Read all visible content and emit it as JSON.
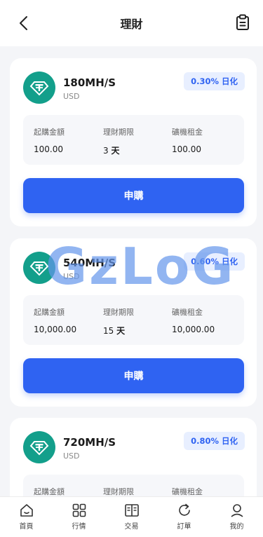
{
  "header": {
    "title": "理財"
  },
  "products": [
    {
      "name": "180MH/S",
      "unit": "USD",
      "rate": "0.30% 日化",
      "labels": {
        "amount": "起購金額",
        "period": "理財期限",
        "rent": "礦機租金"
      },
      "amount": "100.00",
      "period_num": "3",
      "period_unit": "天",
      "rent": "100.00",
      "button": "申購"
    },
    {
      "name": "540MH/S",
      "unit": "USD",
      "rate": "0.60% 日化",
      "labels": {
        "amount": "起購金額",
        "period": "理財期限",
        "rent": "礦機租金"
      },
      "amount": "10,000.00",
      "period_num": "15",
      "period_unit": "天",
      "rent": "10,000.00",
      "button": "申購"
    },
    {
      "name": "720MH/S",
      "unit": "USD",
      "rate": "0.80% 日化",
      "labels": {
        "amount": "起購金額",
        "period": "理財期限",
        "rent": "礦機租金"
      }
    }
  ],
  "watermark": "GzLoG",
  "tabbar": [
    {
      "label": "首頁",
      "icon": "home-icon"
    },
    {
      "label": "行情",
      "icon": "grid-icon"
    },
    {
      "label": "交易",
      "icon": "book-icon"
    },
    {
      "label": "訂單",
      "icon": "refresh-icon"
    },
    {
      "label": "我的",
      "icon": "person-icon"
    }
  ],
  "colors": {
    "accent": "#2f63f2",
    "tether": "#139f8b",
    "rate_bg": "#e8efff"
  }
}
